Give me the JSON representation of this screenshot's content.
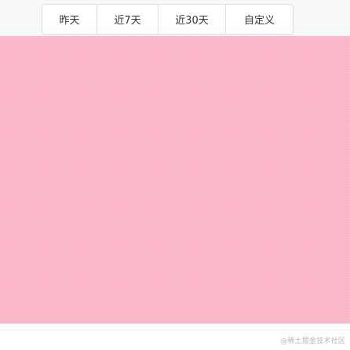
{
  "date_range_selector": {
    "options": [
      {
        "label": "昨天"
      },
      {
        "label": "近7天"
      },
      {
        "label": "近30天"
      },
      {
        "label": "自定义"
      }
    ]
  },
  "canvas": {
    "fill_color": "#fbb6c8"
  },
  "watermark": {
    "text": "@稀土掘金技术社区"
  }
}
